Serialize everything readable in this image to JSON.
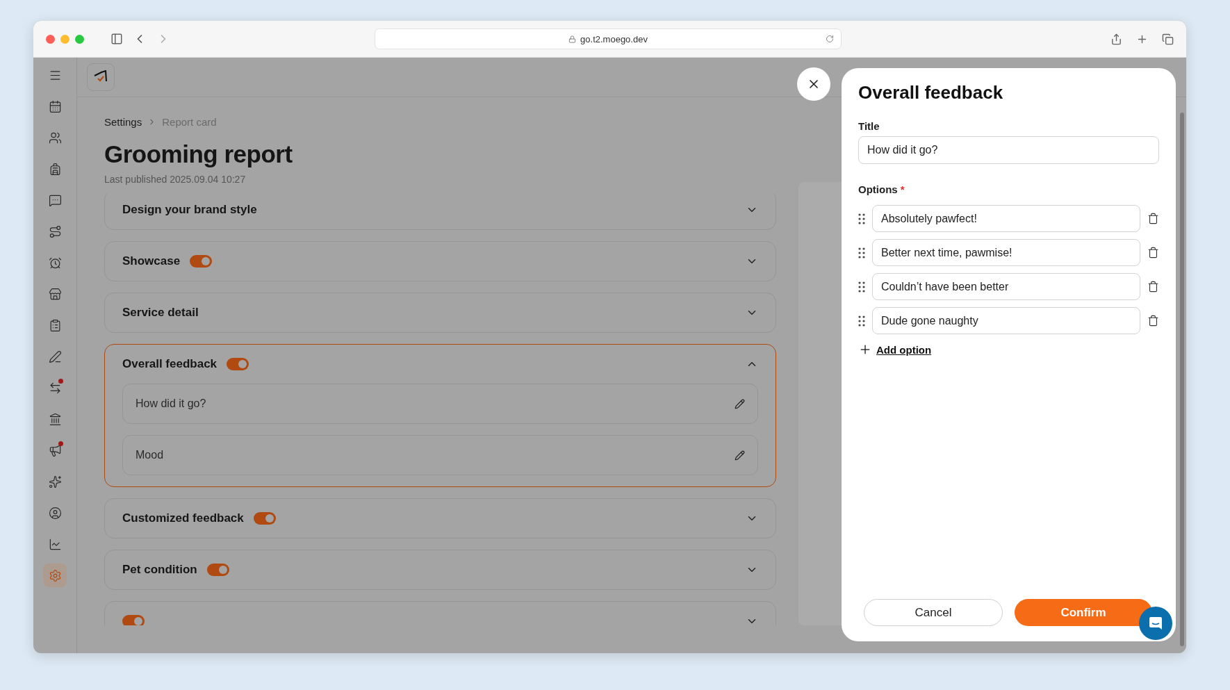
{
  "browser": {
    "url": "go.t2.moego.dev"
  },
  "sidebar": {
    "items": [
      {
        "selected": false,
        "dot": false
      },
      {
        "selected": false,
        "dot": false
      },
      {
        "selected": false,
        "dot": false
      },
      {
        "selected": false,
        "dot": false
      },
      {
        "selected": false,
        "dot": false
      },
      {
        "selected": false,
        "dot": false
      },
      {
        "selected": false,
        "dot": false
      },
      {
        "selected": false,
        "dot": false
      },
      {
        "selected": false,
        "dot": false
      },
      {
        "selected": false,
        "dot": false
      },
      {
        "selected": false,
        "dot": true
      },
      {
        "selected": false,
        "dot": false
      },
      {
        "selected": false,
        "dot": true
      },
      {
        "selected": false,
        "dot": false
      },
      {
        "selected": false,
        "dot": false
      },
      {
        "selected": false,
        "dot": false
      },
      {
        "selected": true,
        "dot": false
      }
    ]
  },
  "breadcrumb": [
    "Settings",
    "Report card"
  ],
  "page": {
    "title": "Grooming report",
    "subtitle": "Last published 2025.09.04 10:27"
  },
  "sections": [
    {
      "title": "Design your brand style",
      "expanded": false
    },
    {
      "title": "Showcase",
      "enabled": true,
      "expanded": false
    },
    {
      "title": "Service detail",
      "expanded": false
    },
    {
      "title": "Overall feedback",
      "enabled": true,
      "expanded": true,
      "fields": [
        "How did it go?",
        "Mood"
      ]
    },
    {
      "title": "Customized feedback",
      "enabled": true,
      "expanded": false
    },
    {
      "title": "Pet condition",
      "enabled": true,
      "expanded": false
    },
    {
      "enabled": true,
      "expanded": false
    }
  ],
  "dialog": {
    "heading": "Overall feedback",
    "title_label": "Title",
    "title_value": "How did it go?",
    "options_label": "Options",
    "required_mark": "*",
    "options": [
      "Absolutely pawfect!",
      "Better next time, pawmise!",
      "Couldn’t have been better",
      "Dude gone naughty"
    ],
    "add_option": "Add option",
    "cancel": "Cancel",
    "confirm": "Confirm"
  }
}
